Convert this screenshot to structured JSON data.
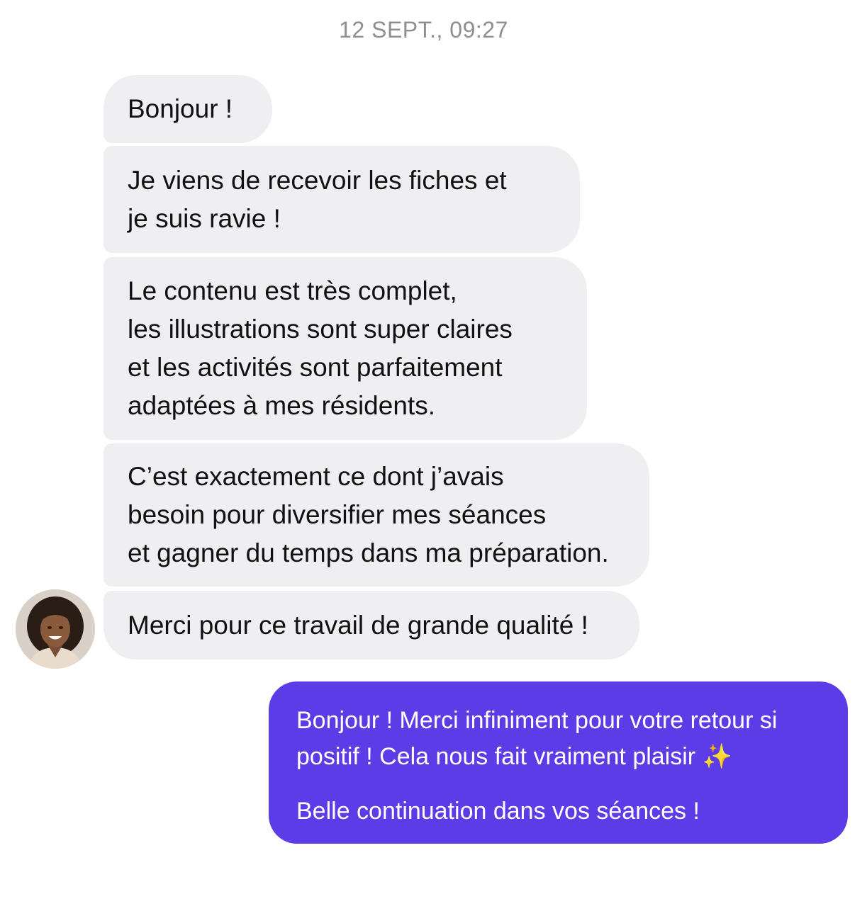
{
  "conversation": {
    "timestamp": "12 SEPT., 09:27",
    "incoming": [
      {
        "lines": [
          "Bonjour !"
        ]
      },
      {
        "lines": [
          "Je viens de recevoir les fiches et",
          "je suis ravie !"
        ]
      },
      {
        "lines": [
          "Le contenu est très complet,",
          "les illustrations sont super claires",
          "et les activités sont parfaitement",
          "adaptées à mes résidents."
        ]
      },
      {
        "lines": [
          "C’est exactement ce dont j’avais",
          "besoin pour diversifier mes séances",
          "et gagner du temps dans ma préparation."
        ]
      },
      {
        "lines": [
          "Merci pour ce travail de grande qualité !"
        ]
      }
    ],
    "outgoing": {
      "paragraph1_lines": [
        "Bonjour ! Merci infiniment pour votre retour si",
        "positif ! Cela nous fait vraiment plaisir"
      ],
      "sparkle": "✨",
      "paragraph2": "Belle continuation dans vos séances !"
    },
    "colors": {
      "incoming_bubble": "#efeff2",
      "outgoing_bubble": "#5b3ce6",
      "timestamp": "#8e8e93"
    }
  }
}
